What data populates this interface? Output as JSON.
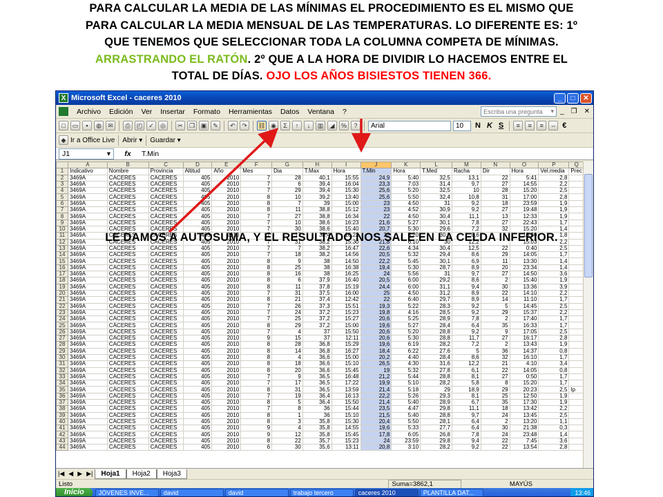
{
  "caption": {
    "line1": "PARA CALCULAR LA MEDIA DE LAS MÍNIMAS EL PROCEDIMIENTO ES EL MISMO QUE",
    "line2": "PARA CALCULAR LA MEDIA MENSUAL DE LAS TEMPERATURAS. LO DIFERENTE ES: 1º",
    "line3": "QUE TENEMOS QUE SELECCIONAR TODA LA COLUMNA COMPETA DE MÍNIMAS.",
    "line4_green": "ARRASTRANDO EL RATÓN",
    "line4_rest": ". 2º QUE A LA HORA DE DIVIDIR LO HACEMOS ENTRE EL",
    "line5_black": "TOTAL DE DÍAS.",
    "line5_red": " OJO LOS AÑOS BISIESTOS TIENEN 366."
  },
  "overlay_text": "LE DAMOS A AUTOSUMA, Y EL RESULTADO NOS SALE EN LA CELDA  INFERIOR.",
  "window": {
    "title": "Microsoft Excel - caceres 2010",
    "menu": [
      "Archivo",
      "Edición",
      "Ver",
      "Insertar",
      "Formato",
      "Herramientas",
      "Datos",
      "Ventana",
      "?"
    ],
    "ask_placeholder": "Escriba una pregunta",
    "font_name": "Arial",
    "font_size": "10",
    "bold": "N",
    "italic": "K",
    "underline": "S",
    "currency": "€",
    "office_live": "Ir a Office Live",
    "open_label": "Abrir ▾",
    "save_label": "Guardar ▾",
    "namebox": "J1",
    "fx": "fx",
    "formula": "T.Min"
  },
  "columns": [
    "A",
    "B",
    "C",
    "D",
    "E",
    "F",
    "G",
    "H",
    "I",
    "J",
    "K",
    "L",
    "M",
    "N",
    "O",
    "P",
    "Q"
  ],
  "headers": [
    "Indicativo",
    "Nombre",
    "Provincia",
    "Altitud",
    "Año",
    "Mes",
    "Dia",
    "T.Max",
    "Hora",
    "T.Min",
    "Hora",
    "T.Med",
    "Racha",
    "Dir",
    "Hora",
    "Vel.media",
    "Prec"
  ],
  "rows": [
    [
      "3469A",
      "CÁCERES",
      "CÁCERES",
      "405",
      "2010",
      "7",
      "28",
      "40,1",
      "15:55",
      "24,9",
      "5:40",
      "32,5",
      "13,1",
      "22",
      "5:41",
      "2,8",
      ""
    ],
    [
      "3469A",
      "CÁCERES",
      "CÁCERES",
      "405",
      "2010",
      "7",
      "6",
      "39,4",
      "16:04",
      "23,3",
      "7:03",
      "31,4",
      "9,7",
      "27",
      "14:55",
      "2,2",
      ""
    ],
    [
      "3469A",
      "CÁCERES",
      "CÁCERES",
      "405",
      "2010",
      "7",
      "29",
      "39,4",
      "15:30",
      "25,6",
      "5:20",
      "32,5",
      "10",
      "28",
      "15:20",
      "2,5",
      ""
    ],
    [
      "3469A",
      "CÁCERES",
      "CÁCERES",
      "405",
      "2010",
      "8",
      "10",
      "39,2",
      "13:40",
      "25,6",
      "5:50",
      "32,4",
      "10,8",
      "31",
      "17:00",
      "2,8",
      ""
    ],
    [
      "3469A",
      "CÁCERES",
      "CÁCERES",
      "405",
      "2010",
      "8",
      "7",
      "39",
      "15:00",
      "23",
      "4:50",
      "31",
      "9,2",
      "18",
      "23:59",
      "1,9",
      ""
    ],
    [
      "3469A",
      "CÁCERES",
      "CÁCERES",
      "405",
      "2010",
      "8",
      "11",
      "38,8",
      "15:12",
      "23",
      "4:52",
      "30,9",
      "9,2",
      "27",
      "19:48",
      "1,9",
      ""
    ],
    [
      "3469A",
      "CÁCERES",
      "CÁCERES",
      "405",
      "2010",
      "7",
      "27",
      "38,8",
      "16:34",
      "22",
      "4:50",
      "30,4",
      "11,1",
      "13",
      "12:33",
      "1,9",
      ""
    ],
    [
      "3469A",
      "CÁCERES",
      "CÁCERES",
      "405",
      "2010",
      "7",
      "10",
      "38,6",
      "16:23",
      "21,6",
      "5:27",
      "30,1",
      "7,8",
      "27",
      "22:43",
      "1,7",
      ""
    ],
    [
      "3469A",
      "CÁCERES",
      "CÁCERES",
      "405",
      "2010",
      "7",
      "30",
      "38,6",
      "15:40",
      "20,7",
      "5:30",
      "29,6",
      "7,2",
      "32",
      "15:20",
      "1,4",
      ""
    ],
    [
      "3469A",
      "CÁCERES",
      "CÁCERES",
      "405",
      "2010",
      "7",
      "17",
      "38,4",
      "16:22",
      "22",
      "5:20",
      "30,2",
      "8,6",
      "",
      "13:30",
      "1,8",
      ""
    ],
    [
      "3469A",
      "CÁCERES",
      "CÁCERES",
      "405",
      "2010",
      "7",
      "31",
      "38,2",
      "15:30",
      "21,8",
      "6:10",
      "30",
      "12,2",
      "",
      "15:03",
      "2,2",
      ""
    ],
    [
      "3469A",
      "CÁCERES",
      "CÁCERES",
      "405",
      "2010",
      "7",
      "7",
      "38,2",
      "16:47",
      "22,6",
      "4:34",
      "30,4",
      "12,5",
      "22",
      "0:40",
      "2,5",
      ""
    ],
    [
      "3469A",
      "CÁCERES",
      "CÁCERES",
      "405",
      "2010",
      "7",
      "18",
      "38,2",
      "14:56",
      "20,5",
      "5:32",
      "29,4",
      "8,6",
      "29",
      "14:05",
      "1,7",
      ""
    ],
    [
      "3469A",
      "CÁCERES",
      "CÁCERES",
      "405",
      "2010",
      "8",
      "9",
      "38",
      "14:50",
      "22,2",
      "5:45",
      "30,1",
      "6,9",
      "11",
      "13:30",
      "1,4",
      ""
    ],
    [
      "3469A",
      "CÁCERES",
      "CÁCERES",
      "405",
      "2010",
      "8",
      "25",
      "38",
      "16:38",
      "19,4",
      "5:30",
      "28,7",
      "8,9",
      "20",
      "23:34",
      "1,4",
      ""
    ],
    [
      "3469A",
      "CÁCERES",
      "CÁCERES",
      "405",
      "2010",
      "8",
      "16",
      "38",
      "16:25",
      "24",
      "5:56",
      "31",
      "9,7",
      "27",
      "14:50",
      "3,6",
      ""
    ],
    [
      "3469A",
      "CÁCERES",
      "CÁCERES",
      "405",
      "2010",
      "8",
      "6",
      "37,9",
      "16:40",
      "20,5",
      "6:00",
      "29,2",
      "8,6",
      "2",
      "15:40",
      "1,9",
      ""
    ],
    [
      "3469A",
      "CÁCERES",
      "CÁCERES",
      "405",
      "2010",
      "8",
      "11",
      "37,8",
      "15:19",
      "24,4",
      "6:00",
      "31,1",
      "9,4",
      "30",
      "13:36",
      "3,9",
      ""
    ],
    [
      "3469A",
      "CÁCERES",
      "CÁCERES",
      "405",
      "2010",
      "7",
      "31",
      "37,5",
      "16:00",
      "25",
      "4:50",
      "31,2",
      "8,9",
      "22",
      "14:10",
      "2,2",
      ""
    ],
    [
      "3469A",
      "CÁCERES",
      "CÁCERES",
      "405",
      "2010",
      "8",
      "21",
      "37,4",
      "12:42",
      "22",
      "6:40",
      "29,7",
      "8,9",
      "14",
      "11:10",
      "1,7",
      ""
    ],
    [
      "3469A",
      "CÁCERES",
      "CÁCERES",
      "405",
      "2010",
      "7",
      "26",
      "37,3",
      "15:51",
      "19,3",
      "5:22",
      "28,3",
      "9,2",
      "5",
      "14:45",
      "2,5",
      ""
    ],
    [
      "3469A",
      "CÁCERES",
      "CÁCERES",
      "405",
      "2010",
      "7",
      "24",
      "37,2",
      "15:23",
      "19,8",
      "4:16",
      "28,5",
      "9,2",
      "29",
      "15:37",
      "2,2",
      ""
    ],
    [
      "3469A",
      "CÁCERES",
      "CÁCERES",
      "405",
      "2010",
      "7",
      "25",
      "37,2",
      "15:27",
      "20,6",
      "5:25",
      "28,9",
      "7,8",
      "2",
      "17:40",
      "1,7",
      ""
    ],
    [
      "3469A",
      "CÁCERES",
      "CÁCERES",
      "405",
      "2010",
      "8",
      "29",
      "37,2",
      "15:00",
      "19,6",
      "5:27",
      "28,4",
      "6,4",
      "35",
      "16:33",
      "1,7",
      ""
    ],
    [
      "3469A",
      "CÁCERES",
      "CÁCERES",
      "405",
      "2010",
      "7",
      "4",
      "37",
      "15:50",
      "20,6",
      "5:20",
      "28,8",
      "9,2",
      "9",
      "17:05",
      "2,5",
      ""
    ],
    [
      "3469A",
      "CÁCERES",
      "CÁCERES",
      "405",
      "2010",
      "9",
      "15",
      "37",
      "12:11",
      "20,6",
      "5:30",
      "28,8",
      "11,7",
      "27",
      "16:17",
      "2,8",
      ""
    ],
    [
      "3469A",
      "CÁCERES",
      "CÁCERES",
      "405",
      "2010",
      "8",
      "28",
      "36,8",
      "15:29",
      "19,6",
      "6:19",
      "28,2",
      "7,2",
      "2",
      "13:43",
      "1,9",
      ""
    ],
    [
      "3469A",
      "CÁCERES",
      "CÁCERES",
      "405",
      "2010",
      "8",
      "14",
      "36,8",
      "16:27",
      "18,4",
      "6:22",
      "27,6",
      "5",
      "36",
      "14:37",
      "0,8",
      ""
    ],
    [
      "3469A",
      "CÁCERES",
      "CÁCERES",
      "405",
      "2010",
      "8",
      "4",
      "36,6",
      "15:00",
      "20,2",
      "4:40",
      "28,4",
      "8,6",
      "32",
      "16:10",
      "1,7",
      ""
    ],
    [
      "3469A",
      "CÁCERES",
      "CÁCERES",
      "405",
      "2010",
      "8",
      "18",
      "36,6",
      "15:10",
      "26,5",
      "4:30",
      "31,6",
      "12,2",
      "21",
      "4:10",
      "3,4",
      ""
    ],
    [
      "3469A",
      "CÁCERES",
      "CÁCERES",
      "405",
      "2010",
      "8",
      "20",
      "36,6",
      "15:45",
      "19",
      "5:32",
      "27,8",
      "6,1",
      "22",
      "14:05",
      "0,8",
      ""
    ],
    [
      "3469A",
      "CÁCERES",
      "CÁCERES",
      "405",
      "2010",
      "7",
      "9",
      "36,5",
      "16:48",
      "21,2",
      "5:44",
      "28,8",
      "8,1",
      "27",
      "0:50",
      "1,7",
      ""
    ],
    [
      "3469A",
      "CÁCERES",
      "CÁCERES",
      "405",
      "2010",
      "7",
      "17",
      "36,5",
      "17:22",
      "19,9",
      "5:10",
      "28,2",
      "5,8",
      "8",
      "15:20",
      "1,7",
      ""
    ],
    [
      "3469A",
      "CÁCERES",
      "CÁCERES",
      "405",
      "2010",
      "8",
      "31",
      "36,5",
      "13:59",
      "21,4",
      "5:18",
      "29",
      "18,9",
      "29",
      "20:23",
      "2,5",
      "Ip"
    ],
    [
      "3469A",
      "CÁCERES",
      "CÁCERES",
      "405",
      "2010",
      "7",
      "19",
      "36,4",
      "16:13",
      "22,2",
      "5:26",
      "29,3",
      "8,1",
      "25",
      "12:50",
      "1,9",
      ""
    ],
    [
      "3469A",
      "CÁCERES",
      "CÁCERES",
      "405",
      "2010",
      "8",
      "5",
      "36,4",
      "15:50",
      "21,4",
      "5:40",
      "28,9",
      "6,7",
      "35",
      "17:30",
      "1,9",
      ""
    ],
    [
      "3469A",
      "CÁCERES",
      "CÁCERES",
      "405",
      "2010",
      "7",
      "8",
      "36",
      "15:44",
      "23,5",
      "4:47",
      "29,8",
      "11,1",
      "18",
      "13:42",
      "2,2",
      ""
    ],
    [
      "3469A",
      "CÁCERES",
      "CÁCERES",
      "405",
      "2010",
      "8",
      "1",
      "36",
      "15:10",
      "21,5",
      "5:40",
      "28,8",
      "9,7",
      "24",
      "13:45",
      "2,5",
      ""
    ],
    [
      "3469A",
      "CÁCERES",
      "CÁCERES",
      "405",
      "2010",
      "8",
      "3",
      "35,8",
      "15:30",
      "20,4",
      "5:50",
      "28,1",
      "6,4",
      "2",
      "13:20",
      "1,1",
      ""
    ],
    [
      "3469A",
      "CÁCERES",
      "CÁCERES",
      "405",
      "2010",
      "9",
      "4",
      "35,8",
      "14:55",
      "19,6",
      "5:33",
      "27,7",
      "6,4",
      "30",
      "21:38",
      "0,3",
      ""
    ],
    [
      "3469A",
      "CÁCERES",
      "CÁCERES",
      "405",
      "2010",
      "9",
      "12",
      "35,8",
      "15:45",
      "17,8",
      "6:05",
      "26,8",
      "7,8",
      "24",
      "23:48",
      "1,4",
      ""
    ],
    [
      "3469A",
      "CÁCERES",
      "CÁCERES",
      "405",
      "2010",
      "8",
      "22",
      "35,7",
      "15:23",
      "24",
      "23:59",
      "29,8",
      "9,4",
      "22",
      "7:45",
      "3,6",
      ""
    ],
    [
      "3469A",
      "CÁCERES",
      "CÁCERES",
      "405",
      "2010",
      "6",
      "30",
      "35,6",
      "13:11",
      "20,8",
      "3:10",
      "28,2",
      "9,2",
      "22",
      "13:54",
      "2,8",
      ""
    ]
  ],
  "first_row_number": 1,
  "selected_column": "J",
  "sheet_tabs": [
    "Hoja1",
    "Hoja2",
    "Hoja3"
  ],
  "status": {
    "ready": "Listo",
    "sum": "Suma=3862,1",
    "caps": "MAYÚS"
  },
  "taskbar": {
    "start": "Inicio",
    "tasks": [
      "JÓVENES INVE...",
      "david",
      "david",
      "trabajo tercero",
      "caceres 2010",
      "PLANTILLA DAT..."
    ],
    "clock": "13:46"
  },
  "colors": {
    "selection": "#c6d3ef",
    "arrow": "#e01818",
    "caption_green": "#7bbb1e",
    "caption_red": "#ff0000"
  }
}
